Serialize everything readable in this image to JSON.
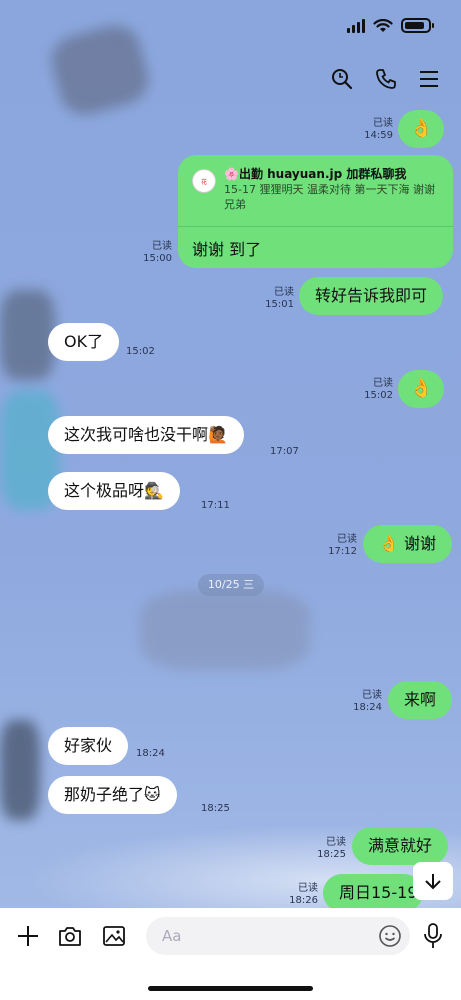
{
  "header": {
    "icons": [
      "search-icon",
      "phone-icon",
      "menu-icon"
    ]
  },
  "messages": [
    {
      "side": "me",
      "text": "👌",
      "read": "已读",
      "time": "14:59"
    },
    {
      "side": "me",
      "type": "card",
      "card_title": "🌸出勤 huayuan.jp  加群私聊我",
      "card_sub": "15-17 狸狸明天 温柔对待 第一天下海 谢谢兄弟",
      "text": "谢谢 到了",
      "read": "已读",
      "time": "15:00"
    },
    {
      "side": "me",
      "text": "转好告诉我即可",
      "read": "已读",
      "time": "15:01"
    },
    {
      "side": "them",
      "text": "OK了",
      "time": "15:02"
    },
    {
      "side": "me",
      "text": "👌",
      "read": "已读",
      "time": "15:02"
    },
    {
      "side": "them",
      "text": "这次我可啥也没干啊🙋🏾",
      "time": "17:07"
    },
    {
      "side": "them",
      "text": "这个极品呀🕵️",
      "time": "17:11"
    },
    {
      "side": "me",
      "text": "👌 谢谢",
      "read": "已读",
      "time": "17:12"
    },
    {
      "side": "me",
      "text": "来啊",
      "read": "已读",
      "time": "18:24"
    },
    {
      "side": "them",
      "text": "好家伙",
      "time": "18:24"
    },
    {
      "side": "them",
      "text": "那奶子绝了🐱",
      "time": "18:25"
    },
    {
      "side": "me",
      "text": "满意就好",
      "read": "已读",
      "time": "18:25"
    },
    {
      "side": "me",
      "text": "周日15-19",
      "read": "已读",
      "time": "18:26"
    }
  ],
  "date_separator": "10/25 三",
  "composer": {
    "placeholder": "Aa",
    "icons": [
      "plus-icon",
      "camera-icon",
      "image-icon",
      "emoji-icon",
      "mic-icon"
    ]
  }
}
